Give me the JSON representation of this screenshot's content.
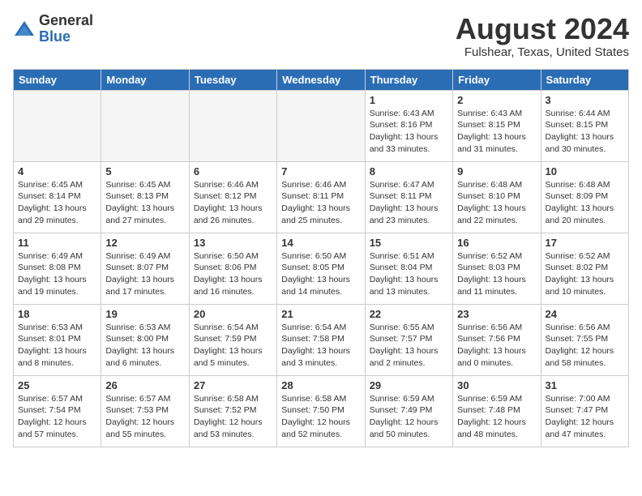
{
  "header": {
    "logo_general": "General",
    "logo_blue": "Blue",
    "month_title": "August 2024",
    "location": "Fulshear, Texas, United States"
  },
  "weekdays": [
    "Sunday",
    "Monday",
    "Tuesday",
    "Wednesday",
    "Thursday",
    "Friday",
    "Saturday"
  ],
  "weeks": [
    [
      {
        "day": "",
        "info": ""
      },
      {
        "day": "",
        "info": ""
      },
      {
        "day": "",
        "info": ""
      },
      {
        "day": "",
        "info": ""
      },
      {
        "day": "1",
        "info": "Sunrise: 6:43 AM\nSunset: 8:16 PM\nDaylight: 13 hours\nand 33 minutes."
      },
      {
        "day": "2",
        "info": "Sunrise: 6:43 AM\nSunset: 8:15 PM\nDaylight: 13 hours\nand 31 minutes."
      },
      {
        "day": "3",
        "info": "Sunrise: 6:44 AM\nSunset: 8:15 PM\nDaylight: 13 hours\nand 30 minutes."
      }
    ],
    [
      {
        "day": "4",
        "info": "Sunrise: 6:45 AM\nSunset: 8:14 PM\nDaylight: 13 hours\nand 29 minutes."
      },
      {
        "day": "5",
        "info": "Sunrise: 6:45 AM\nSunset: 8:13 PM\nDaylight: 13 hours\nand 27 minutes."
      },
      {
        "day": "6",
        "info": "Sunrise: 6:46 AM\nSunset: 8:12 PM\nDaylight: 13 hours\nand 26 minutes."
      },
      {
        "day": "7",
        "info": "Sunrise: 6:46 AM\nSunset: 8:11 PM\nDaylight: 13 hours\nand 25 minutes."
      },
      {
        "day": "8",
        "info": "Sunrise: 6:47 AM\nSunset: 8:11 PM\nDaylight: 13 hours\nand 23 minutes."
      },
      {
        "day": "9",
        "info": "Sunrise: 6:48 AM\nSunset: 8:10 PM\nDaylight: 13 hours\nand 22 minutes."
      },
      {
        "day": "10",
        "info": "Sunrise: 6:48 AM\nSunset: 8:09 PM\nDaylight: 13 hours\nand 20 minutes."
      }
    ],
    [
      {
        "day": "11",
        "info": "Sunrise: 6:49 AM\nSunset: 8:08 PM\nDaylight: 13 hours\nand 19 minutes."
      },
      {
        "day": "12",
        "info": "Sunrise: 6:49 AM\nSunset: 8:07 PM\nDaylight: 13 hours\nand 17 minutes."
      },
      {
        "day": "13",
        "info": "Sunrise: 6:50 AM\nSunset: 8:06 PM\nDaylight: 13 hours\nand 16 minutes."
      },
      {
        "day": "14",
        "info": "Sunrise: 6:50 AM\nSunset: 8:05 PM\nDaylight: 13 hours\nand 14 minutes."
      },
      {
        "day": "15",
        "info": "Sunrise: 6:51 AM\nSunset: 8:04 PM\nDaylight: 13 hours\nand 13 minutes."
      },
      {
        "day": "16",
        "info": "Sunrise: 6:52 AM\nSunset: 8:03 PM\nDaylight: 13 hours\nand 11 minutes."
      },
      {
        "day": "17",
        "info": "Sunrise: 6:52 AM\nSunset: 8:02 PM\nDaylight: 13 hours\nand 10 minutes."
      }
    ],
    [
      {
        "day": "18",
        "info": "Sunrise: 6:53 AM\nSunset: 8:01 PM\nDaylight: 13 hours\nand 8 minutes."
      },
      {
        "day": "19",
        "info": "Sunrise: 6:53 AM\nSunset: 8:00 PM\nDaylight: 13 hours\nand 6 minutes."
      },
      {
        "day": "20",
        "info": "Sunrise: 6:54 AM\nSunset: 7:59 PM\nDaylight: 13 hours\nand 5 minutes."
      },
      {
        "day": "21",
        "info": "Sunrise: 6:54 AM\nSunset: 7:58 PM\nDaylight: 13 hours\nand 3 minutes."
      },
      {
        "day": "22",
        "info": "Sunrise: 6:55 AM\nSunset: 7:57 PM\nDaylight: 13 hours\nand 2 minutes."
      },
      {
        "day": "23",
        "info": "Sunrise: 6:56 AM\nSunset: 7:56 PM\nDaylight: 13 hours\nand 0 minutes."
      },
      {
        "day": "24",
        "info": "Sunrise: 6:56 AM\nSunset: 7:55 PM\nDaylight: 12 hours\nand 58 minutes."
      }
    ],
    [
      {
        "day": "25",
        "info": "Sunrise: 6:57 AM\nSunset: 7:54 PM\nDaylight: 12 hours\nand 57 minutes."
      },
      {
        "day": "26",
        "info": "Sunrise: 6:57 AM\nSunset: 7:53 PM\nDaylight: 12 hours\nand 55 minutes."
      },
      {
        "day": "27",
        "info": "Sunrise: 6:58 AM\nSunset: 7:52 PM\nDaylight: 12 hours\nand 53 minutes."
      },
      {
        "day": "28",
        "info": "Sunrise: 6:58 AM\nSunset: 7:50 PM\nDaylight: 12 hours\nand 52 minutes."
      },
      {
        "day": "29",
        "info": "Sunrise: 6:59 AM\nSunset: 7:49 PM\nDaylight: 12 hours\nand 50 minutes."
      },
      {
        "day": "30",
        "info": "Sunrise: 6:59 AM\nSunset: 7:48 PM\nDaylight: 12 hours\nand 48 minutes."
      },
      {
        "day": "31",
        "info": "Sunrise: 7:00 AM\nSunset: 7:47 PM\nDaylight: 12 hours\nand 47 minutes."
      }
    ]
  ]
}
